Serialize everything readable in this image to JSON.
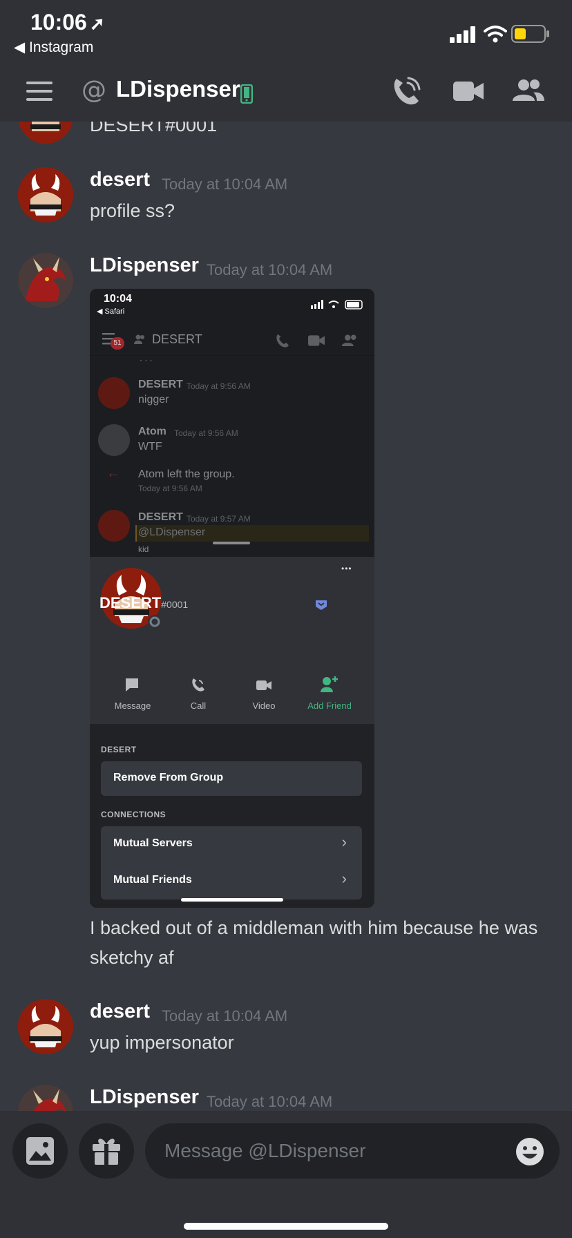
{
  "status_bar": {
    "time": "10:06",
    "back_app": "◀ Instagram"
  },
  "header": {
    "at_symbol": "@",
    "channel_name": "LDispenser"
  },
  "messages": [
    {
      "text_partial": "DESERT#0001"
    },
    {
      "username": "desert",
      "timestamp": "Today at 10:04 AM",
      "text": "profile ss?"
    },
    {
      "username": "LDispenser",
      "timestamp": "Today at 10:04 AM",
      "text": "I backed out of a middleman with him because he was sketchy af"
    },
    {
      "username": "desert",
      "timestamp": "Today at 10:04 AM",
      "text": "yup impersonator"
    },
    {
      "username": "LDispenser",
      "timestamp": "Today at 10:04 AM"
    }
  ],
  "embed": {
    "status_time": "10:04",
    "back_app": "◀ Safari",
    "header_badge": "51",
    "header_title": "DESERT",
    "partial_top": "· · ·",
    "chat": [
      {
        "user": "DESERT",
        "time": "Today at 9:56 AM",
        "text": "nigger"
      },
      {
        "user": "Atom",
        "time": "Today at 9:56 AM",
        "text": "WTF"
      },
      {
        "system": "Atom left the group.",
        "time": "Today at 9:56 AM"
      },
      {
        "user": "DESERT",
        "time": "Today at 9:57 AM",
        "mention": "@LDispenser",
        "partial": "kid"
      }
    ],
    "profile": {
      "more": "•••",
      "name": "DESERT",
      "discriminator": "#0001",
      "actions": [
        "Message",
        "Call",
        "Video",
        "Add Friend"
      ],
      "section_user": "DESERT",
      "remove": "Remove From Group",
      "section_connections": "CONNECTIONS",
      "mutual_servers": "Mutual Servers",
      "mutual_friends": "Mutual Friends",
      "chevron": "›"
    }
  },
  "composer": {
    "placeholder": "Message @LDispenser"
  },
  "colors": {
    "background": "#36393f",
    "header": "#2f3136",
    "online_green": "#43b581",
    "nitro_purple": "#7289da",
    "input_bg": "#202225"
  }
}
